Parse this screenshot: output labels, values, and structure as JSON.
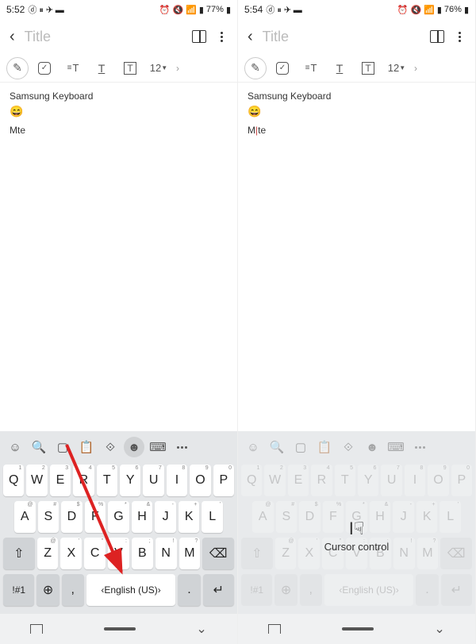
{
  "left": {
    "status": {
      "time": "5:52",
      "battery": "77%"
    },
    "title_placeholder": "Title",
    "font_size": "12",
    "content_title": "Samsung Keyboard",
    "emoji": "😄",
    "text": "Mte",
    "space_label": "English (US)"
  },
  "right": {
    "status": {
      "time": "5:54",
      "battery": "76%"
    },
    "title_placeholder": "Title",
    "font_size": "12",
    "content_title": "Samsung Keyboard",
    "emoji": "😄",
    "text_pre": "M",
    "text_post": "te",
    "space_label": "English (US)",
    "overlay_label": "Cursor control"
  },
  "symbol_key": "!#1",
  "keys": {
    "r1": [
      "Q",
      "W",
      "E",
      "R",
      "T",
      "Y",
      "U",
      "I",
      "O",
      "P"
    ],
    "r1s": [
      "1",
      "2",
      "3",
      "4",
      "5",
      "6",
      "7",
      "8",
      "9",
      "0"
    ],
    "r2": [
      "A",
      "S",
      "D",
      "F",
      "G",
      "H",
      "J",
      "K",
      "L"
    ],
    "r2s": [
      "@",
      "#",
      "$",
      "%",
      "*",
      "&",
      "-",
      "+",
      "'"
    ],
    "r3": [
      "Z",
      "X",
      "C",
      "V",
      "B",
      "N",
      "M"
    ],
    "r3s": [
      "@",
      "'",
      "\"",
      ":",
      ";",
      "!",
      "?"
    ]
  }
}
